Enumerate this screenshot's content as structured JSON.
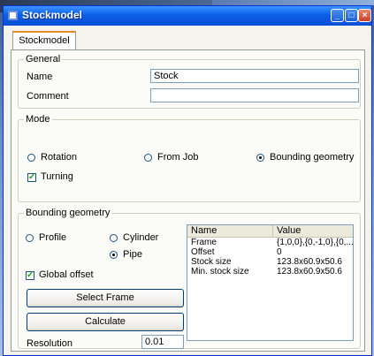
{
  "window": {
    "title": "Stockmodel",
    "tab_label": "Stockmodel"
  },
  "general": {
    "legend": "General",
    "name_label": "Name",
    "name_value": "Stock",
    "comment_label": "Comment",
    "comment_value": ""
  },
  "mode": {
    "legend": "Mode",
    "options": [
      "Rotation",
      "From Job",
      "Bounding geometry"
    ],
    "selected": "Bounding geometry",
    "turning_label": "Turning",
    "turning_checked": true
  },
  "bounding": {
    "legend": "Bounding geometry",
    "shape_options": [
      "Profile",
      "Cylinder",
      "Pipe"
    ],
    "shape_selected": "Pipe",
    "global_offset_label": "Global offset",
    "global_offset_checked": true,
    "select_frame_label": "Select Frame",
    "calculate_label": "Calculate",
    "resolution_label": "Resolution",
    "resolution_value": "0.01"
  },
  "properties": {
    "columns": [
      "Name",
      "Value"
    ],
    "rows": [
      {
        "name": "Frame",
        "value": "{1,0,0},{0,-1,0},{0,..."
      },
      {
        "name": "Offset",
        "value": "0"
      },
      {
        "name": "Stock size",
        "value": "123.8x60.9x50.6"
      },
      {
        "name": "Min. stock size",
        "value": "123.8x60.9x50.6"
      }
    ]
  },
  "colors": {
    "titlebar": "#0a5fe8",
    "accent_tab": "#e68b2c"
  }
}
